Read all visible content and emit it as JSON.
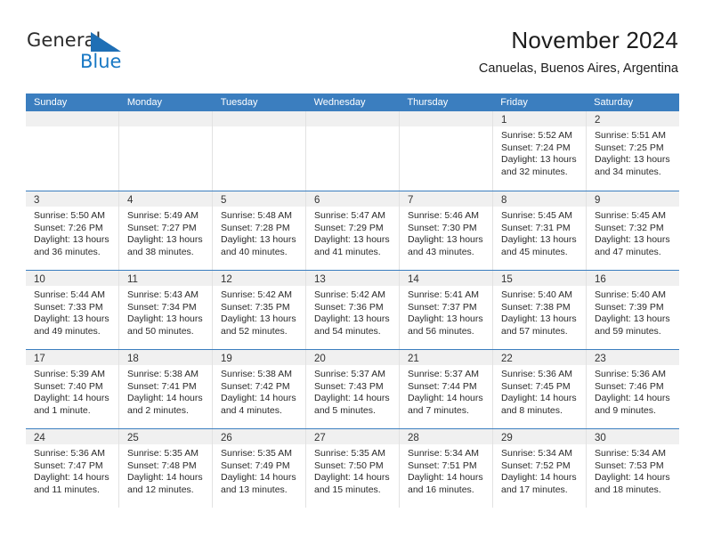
{
  "brand": {
    "name_part1": "General",
    "name_part2": "Blue",
    "accent_color": "#1878c4",
    "triangle_color": "#1f6fb5"
  },
  "header": {
    "title": "November 2024",
    "location": "Canuelas, Buenos Aires, Argentina"
  },
  "calendar": {
    "header_bg": "#3b7ebf",
    "daynum_bg": "#f0f0f0",
    "weekday_headers": [
      "Sunday",
      "Monday",
      "Tuesday",
      "Wednesday",
      "Thursday",
      "Friday",
      "Saturday"
    ],
    "weeks": [
      [
        {
          "day": "",
          "lines": []
        },
        {
          "day": "",
          "lines": []
        },
        {
          "day": "",
          "lines": []
        },
        {
          "day": "",
          "lines": []
        },
        {
          "day": "",
          "lines": []
        },
        {
          "day": "1",
          "lines": [
            "Sunrise: 5:52 AM",
            "Sunset: 7:24 PM",
            "Daylight: 13 hours",
            "and 32 minutes."
          ]
        },
        {
          "day": "2",
          "lines": [
            "Sunrise: 5:51 AM",
            "Sunset: 7:25 PM",
            "Daylight: 13 hours",
            "and 34 minutes."
          ]
        }
      ],
      [
        {
          "day": "3",
          "lines": [
            "Sunrise: 5:50 AM",
            "Sunset: 7:26 PM",
            "Daylight: 13 hours",
            "and 36 minutes."
          ]
        },
        {
          "day": "4",
          "lines": [
            "Sunrise: 5:49 AM",
            "Sunset: 7:27 PM",
            "Daylight: 13 hours",
            "and 38 minutes."
          ]
        },
        {
          "day": "5",
          "lines": [
            "Sunrise: 5:48 AM",
            "Sunset: 7:28 PM",
            "Daylight: 13 hours",
            "and 40 minutes."
          ]
        },
        {
          "day": "6",
          "lines": [
            "Sunrise: 5:47 AM",
            "Sunset: 7:29 PM",
            "Daylight: 13 hours",
            "and 41 minutes."
          ]
        },
        {
          "day": "7",
          "lines": [
            "Sunrise: 5:46 AM",
            "Sunset: 7:30 PM",
            "Daylight: 13 hours",
            "and 43 minutes."
          ]
        },
        {
          "day": "8",
          "lines": [
            "Sunrise: 5:45 AM",
            "Sunset: 7:31 PM",
            "Daylight: 13 hours",
            "and 45 minutes."
          ]
        },
        {
          "day": "9",
          "lines": [
            "Sunrise: 5:45 AM",
            "Sunset: 7:32 PM",
            "Daylight: 13 hours",
            "and 47 minutes."
          ]
        }
      ],
      [
        {
          "day": "10",
          "lines": [
            "Sunrise: 5:44 AM",
            "Sunset: 7:33 PM",
            "Daylight: 13 hours",
            "and 49 minutes."
          ]
        },
        {
          "day": "11",
          "lines": [
            "Sunrise: 5:43 AM",
            "Sunset: 7:34 PM",
            "Daylight: 13 hours",
            "and 50 minutes."
          ]
        },
        {
          "day": "12",
          "lines": [
            "Sunrise: 5:42 AM",
            "Sunset: 7:35 PM",
            "Daylight: 13 hours",
            "and 52 minutes."
          ]
        },
        {
          "day": "13",
          "lines": [
            "Sunrise: 5:42 AM",
            "Sunset: 7:36 PM",
            "Daylight: 13 hours",
            "and 54 minutes."
          ]
        },
        {
          "day": "14",
          "lines": [
            "Sunrise: 5:41 AM",
            "Sunset: 7:37 PM",
            "Daylight: 13 hours",
            "and 56 minutes."
          ]
        },
        {
          "day": "15",
          "lines": [
            "Sunrise: 5:40 AM",
            "Sunset: 7:38 PM",
            "Daylight: 13 hours",
            "and 57 minutes."
          ]
        },
        {
          "day": "16",
          "lines": [
            "Sunrise: 5:40 AM",
            "Sunset: 7:39 PM",
            "Daylight: 13 hours",
            "and 59 minutes."
          ]
        }
      ],
      [
        {
          "day": "17",
          "lines": [
            "Sunrise: 5:39 AM",
            "Sunset: 7:40 PM",
            "Daylight: 14 hours",
            "and 1 minute."
          ]
        },
        {
          "day": "18",
          "lines": [
            "Sunrise: 5:38 AM",
            "Sunset: 7:41 PM",
            "Daylight: 14 hours",
            "and 2 minutes."
          ]
        },
        {
          "day": "19",
          "lines": [
            "Sunrise: 5:38 AM",
            "Sunset: 7:42 PM",
            "Daylight: 14 hours",
            "and 4 minutes."
          ]
        },
        {
          "day": "20",
          "lines": [
            "Sunrise: 5:37 AM",
            "Sunset: 7:43 PM",
            "Daylight: 14 hours",
            "and 5 minutes."
          ]
        },
        {
          "day": "21",
          "lines": [
            "Sunrise: 5:37 AM",
            "Sunset: 7:44 PM",
            "Daylight: 14 hours",
            "and 7 minutes."
          ]
        },
        {
          "day": "22",
          "lines": [
            "Sunrise: 5:36 AM",
            "Sunset: 7:45 PM",
            "Daylight: 14 hours",
            "and 8 minutes."
          ]
        },
        {
          "day": "23",
          "lines": [
            "Sunrise: 5:36 AM",
            "Sunset: 7:46 PM",
            "Daylight: 14 hours",
            "and 9 minutes."
          ]
        }
      ],
      [
        {
          "day": "24",
          "lines": [
            "Sunrise: 5:36 AM",
            "Sunset: 7:47 PM",
            "Daylight: 14 hours",
            "and 11 minutes."
          ]
        },
        {
          "day": "25",
          "lines": [
            "Sunrise: 5:35 AM",
            "Sunset: 7:48 PM",
            "Daylight: 14 hours",
            "and 12 minutes."
          ]
        },
        {
          "day": "26",
          "lines": [
            "Sunrise: 5:35 AM",
            "Sunset: 7:49 PM",
            "Daylight: 14 hours",
            "and 13 minutes."
          ]
        },
        {
          "day": "27",
          "lines": [
            "Sunrise: 5:35 AM",
            "Sunset: 7:50 PM",
            "Daylight: 14 hours",
            "and 15 minutes."
          ]
        },
        {
          "day": "28",
          "lines": [
            "Sunrise: 5:34 AM",
            "Sunset: 7:51 PM",
            "Daylight: 14 hours",
            "and 16 minutes."
          ]
        },
        {
          "day": "29",
          "lines": [
            "Sunrise: 5:34 AM",
            "Sunset: 7:52 PM",
            "Daylight: 14 hours",
            "and 17 minutes."
          ]
        },
        {
          "day": "30",
          "lines": [
            "Sunrise: 5:34 AM",
            "Sunset: 7:53 PM",
            "Daylight: 14 hours",
            "and 18 minutes."
          ]
        }
      ]
    ]
  }
}
